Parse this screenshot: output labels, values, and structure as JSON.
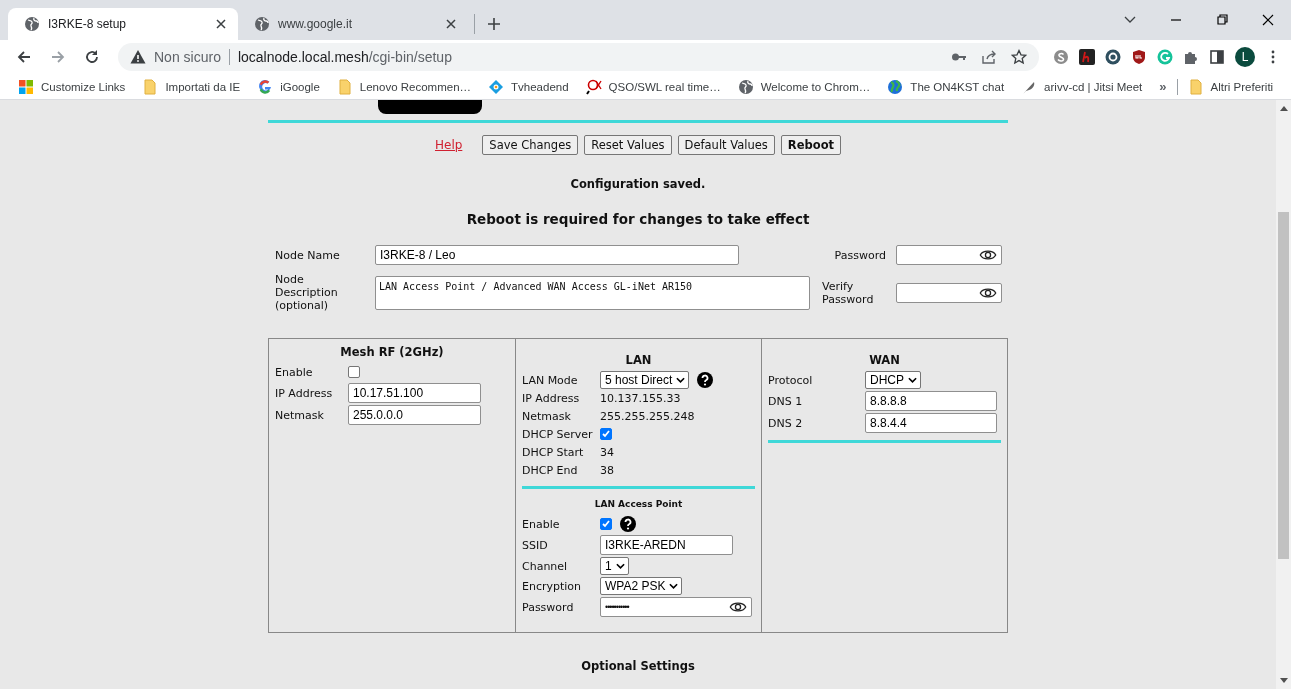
{
  "browser": {
    "tabs": [
      {
        "title": "I3RKE-8 setup",
        "selected": true
      },
      {
        "title": "www.google.it",
        "selected": false
      }
    ],
    "security": "Non sicuro",
    "url_host": "localnode.local.mesh",
    "url_path": "/cgi-bin/setup",
    "profile": "L",
    "bookmarks": [
      {
        "label": "Customize Links",
        "kind": "tiles"
      },
      {
        "label": "Importati da IE",
        "kind": "folder"
      },
      {
        "label": "iGoogle",
        "kind": "g"
      },
      {
        "label": "Lenovo Recommen…",
        "kind": "folder"
      },
      {
        "label": "Tvheadend",
        "kind": "diamond"
      },
      {
        "label": "QSO/SWL real time…",
        "kind": "qso"
      },
      {
        "label": "Welcome to Chrom…",
        "kind": "globe"
      },
      {
        "label": "The ON4KST chat",
        "kind": "earth"
      },
      {
        "label": "arivv-cd | Jitsi Meet",
        "kind": "feather"
      }
    ],
    "overflow": "»",
    "other_bookmarks": "Altri Preferiti"
  },
  "page": {
    "help_link": "Help",
    "buttons": [
      {
        "label": "Save Changes",
        "emphasized": false
      },
      {
        "label": "Reset Values",
        "emphasized": false
      },
      {
        "label": "Default Values",
        "emphasized": false
      },
      {
        "label": "Reboot",
        "emphasized": true
      }
    ],
    "status": "Configuration saved.",
    "notice": "Reboot is required for changes to take effect",
    "node_name": {
      "label": "Node Name",
      "value": "I3RKE-8 / Leo"
    },
    "description": {
      "label": "Node Description (optional)",
      "value": "LAN Access Point / Advanced WAN Access GL-iNet AR150"
    },
    "password": {
      "label": "Password"
    },
    "verify_password": {
      "label": "Verify Password"
    },
    "sections": [
      {
        "title": "Mesh RF (2GHz)",
        "rule": false,
        "rows": [
          {
            "kind": "checkbox",
            "label": "Enable",
            "checked": false,
            "help": false
          },
          {
            "kind": "input",
            "label": "IP Address",
            "value": "10.17.51.100"
          },
          {
            "kind": "input",
            "label": "Netmask",
            "value": "255.0.0.0"
          }
        ]
      },
      {
        "title": "LAN",
        "rule": true,
        "rows": [
          {
            "kind": "select",
            "label": "LAN Mode",
            "value": "5 host Direct",
            "help": true
          },
          {
            "kind": "text",
            "label": "IP Address",
            "value": "10.137.155.33"
          },
          {
            "kind": "text",
            "label": "Netmask",
            "value": "255.255.255.248"
          },
          {
            "kind": "checkbox",
            "label": "DHCP Server",
            "checked": true,
            "help": false
          },
          {
            "kind": "text",
            "label": "DHCP Start",
            "value": "34"
          },
          {
            "kind": "text",
            "label": "DHCP End",
            "value": "38"
          }
        ],
        "subsection": {
          "title": "LAN Access Point",
          "rows": [
            {
              "kind": "checkbox",
              "label": "Enable",
              "checked": true,
              "help": true
            },
            {
              "kind": "input",
              "label": "SSID",
              "value": "I3RKE-AREDN"
            },
            {
              "kind": "select",
              "label": "Channel",
              "value": "1"
            },
            {
              "kind": "select",
              "label": "Encryption",
              "value": "WPA2 PSK"
            },
            {
              "kind": "password",
              "label": "Password",
              "value": "•••••••••••"
            }
          ]
        }
      },
      {
        "title": "WAN",
        "rule": true,
        "rows": [
          {
            "kind": "select",
            "label": "Protocol",
            "value": "DHCP"
          },
          {
            "kind": "input",
            "label": "DNS 1",
            "value": "8.8.8.8"
          },
          {
            "kind": "input",
            "label": "DNS 2",
            "value": "8.8.4.4"
          }
        ]
      }
    ],
    "optional_settings": "Optional Settings"
  }
}
